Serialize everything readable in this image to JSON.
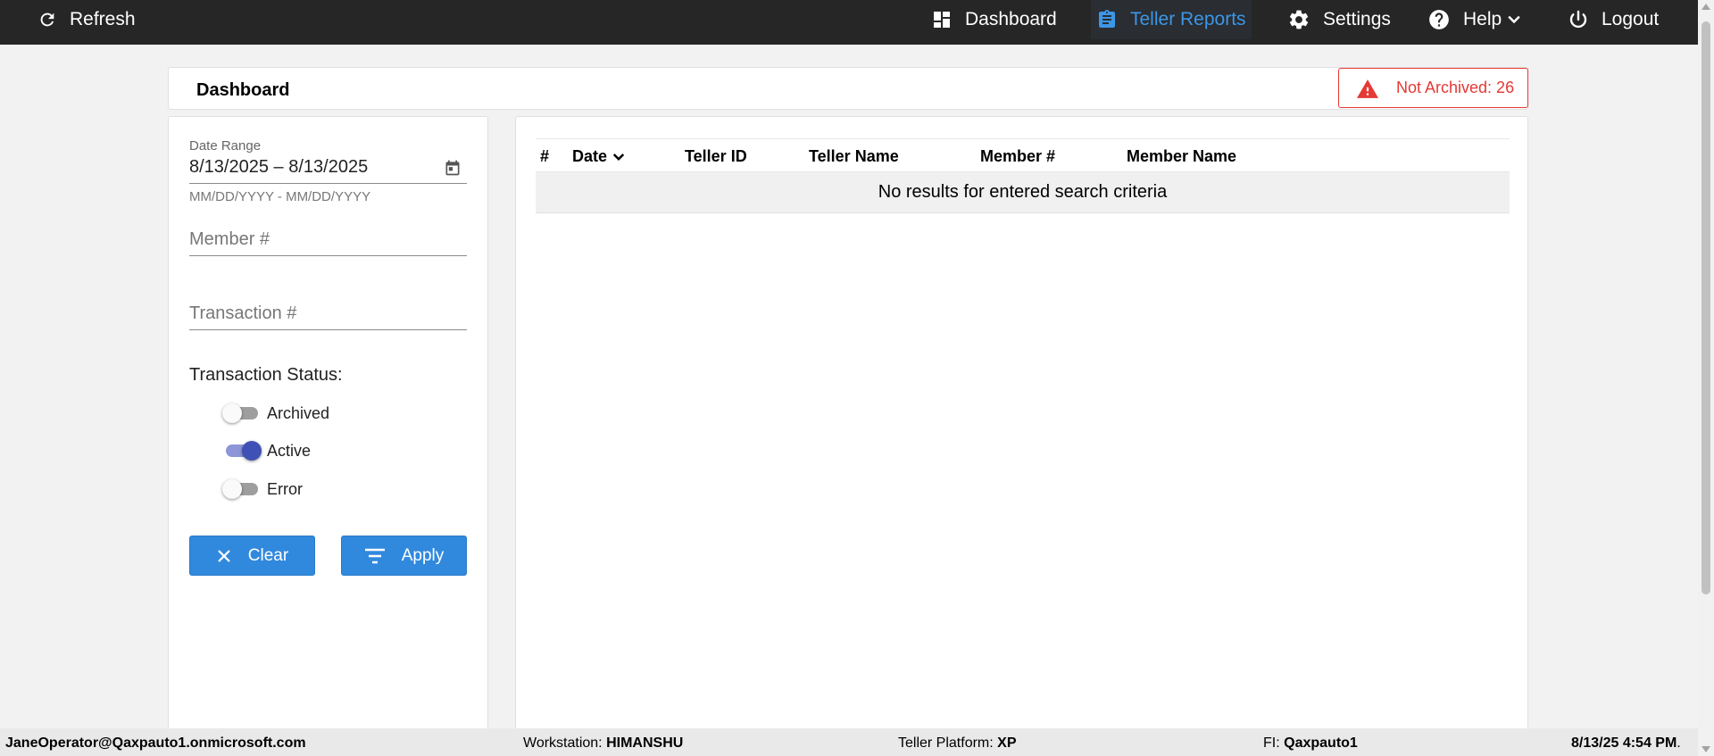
{
  "topbar": {
    "refresh_label": "Refresh",
    "nav": [
      {
        "label": "Dashboard",
        "icon": "dashboard-icon"
      },
      {
        "label": "Teller Reports",
        "icon": "clipboard-icon",
        "active": true
      },
      {
        "label": "Settings",
        "icon": "gear-icon"
      },
      {
        "label": "Help",
        "icon": "help-icon"
      },
      {
        "label": "Logout",
        "icon": "power-icon"
      }
    ],
    "active_color": "#3c96e6"
  },
  "page": {
    "title": "Dashboard",
    "badge_label": "Not Archived: 26",
    "badge_color": "#e53935"
  },
  "filters": {
    "date_range_label": "Date Range",
    "date_range_value": "8/13/2025 – 8/13/2025",
    "date_range_hint": "MM/DD/YYYY - MM/DD/YYYY",
    "member_placeholder": "Member #",
    "transaction_placeholder": "Transaction #",
    "status_label": "Transaction Status:",
    "statuses": [
      {
        "label": "Archived",
        "checked": false
      },
      {
        "label": "Active",
        "checked": true
      },
      {
        "label": "Error",
        "checked": false
      }
    ],
    "clear_label": "Clear",
    "apply_label": "Apply",
    "button_color": "#3189de"
  },
  "table": {
    "columns": [
      "#",
      "Date",
      "Teller ID",
      "Teller Name",
      "Member #",
      "Member Name"
    ],
    "sorted_column": "Date",
    "empty_message": "No results for entered search criteria"
  },
  "footer": {
    "user": "JaneOperator@Qaxpauto1.onmicrosoft.com",
    "workstation_label": "Workstation:",
    "workstation_value": "HIMANSHU",
    "platform_label": "Teller Platform:",
    "platform_value": "XP",
    "fi_label": "FI:",
    "fi_value": "Qaxpauto1",
    "datetime": "8/13/25 4:54 PM",
    "datetime_suffix": "."
  }
}
